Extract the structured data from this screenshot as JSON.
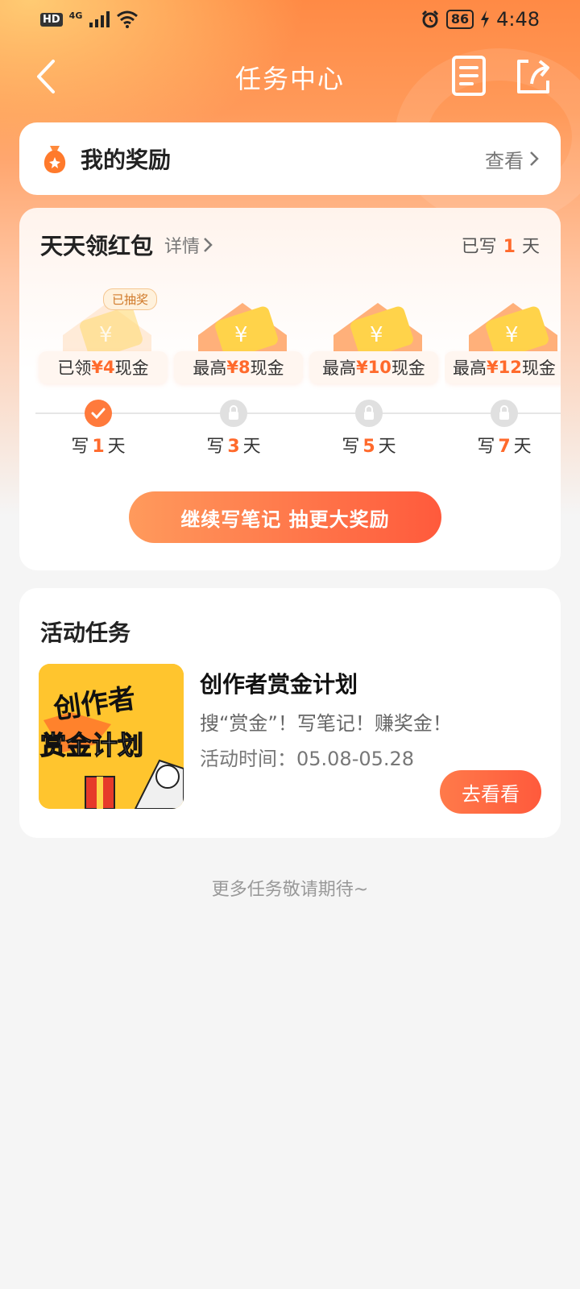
{
  "status_bar": {
    "hd": "HD",
    "network": "4G",
    "battery": "86",
    "time": "4:48"
  },
  "nav": {
    "title": "任务中心"
  },
  "my_rewards": {
    "title": "我的奖励",
    "view": "查看"
  },
  "daily": {
    "title": "天天领红包",
    "detail": "详情",
    "written_prefix": "已写",
    "written_days": "1",
    "written_suffix": "天",
    "rewards": [
      {
        "prefix": "已领",
        "amount": "¥4",
        "suffix": "现金",
        "badge": "已抽奖",
        "day": "1",
        "state": "done"
      },
      {
        "prefix": "最高",
        "amount": "¥8",
        "suffix": "现金",
        "badge": "",
        "day": "3",
        "state": "locked"
      },
      {
        "prefix": "最高",
        "amount": "¥10",
        "suffix": "现金",
        "badge": "",
        "day": "5",
        "state": "locked"
      },
      {
        "prefix": "最高",
        "amount": "¥12",
        "suffix": "现金",
        "badge": "",
        "day": "7",
        "state": "locked"
      }
    ],
    "day_prefix": "写",
    "day_suffix": "天",
    "cta": "继续写笔记 抽更大奖励"
  },
  "tasks": {
    "section_title": "活动任务",
    "items": [
      {
        "name": "创作者赏金计划",
        "desc": "搜“赏金”！写笔记！赚奖金！",
        "time": "活动时间：05.08-05.28",
        "button": "去看看",
        "thumb_text_top": "创作者",
        "thumb_text_bottom": "赏金计划"
      }
    ]
  },
  "footer": {
    "more": "更多任务敬请期待~"
  },
  "colors": {
    "accent": "#ff6a2c",
    "button_start": "#ff9a5c",
    "button_end": "#ff5a3c"
  }
}
